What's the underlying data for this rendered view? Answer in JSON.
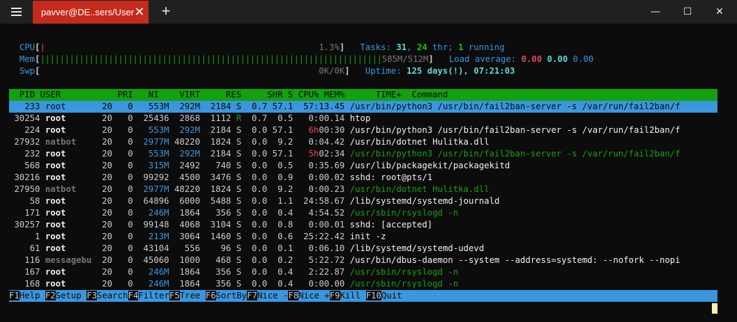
{
  "window": {
    "tab_title": "pavver@DE..sers/User",
    "tab_close": "✕",
    "new_tab": "+",
    "minimize": "—",
    "maximize": "☐",
    "close": "✕"
  },
  "meters": {
    "cpu_label": "CPU",
    "cpu_bar": "|",
    "cpu_value": "1.3%",
    "mem_label": "Mem",
    "mem_bar": "||||||||||||||||||||||||||||||||||||||||||||||||||||||||||||||||||||||",
    "mem_value": "585M/512M",
    "swp_label": "Swp",
    "swp_value": "0K/0K"
  },
  "summary": {
    "tasks_label": "Tasks:",
    "tasks": "31",
    "threads": "24",
    "threads_label": "thr;",
    "running": "1",
    "running_label": "running",
    "load_label": "Load average:",
    "load_1": "0.00",
    "load_5": "0.00",
    "load_15": "0.00",
    "uptime_label": "Uptime:",
    "uptime_value": "125 days(!), 07:21:03"
  },
  "table": {
    "columns": [
      "PID",
      "USER",
      "PRI",
      "NI",
      "VIRT",
      "RES",
      "SHR",
      "S",
      "CPU%",
      "MEM%",
      "TIME+",
      "Command"
    ],
    "rows": [
      {
        "pid": "233",
        "user": "root",
        "pri": "20",
        "ni": "0",
        "virt": "553M",
        "res": "292M",
        "shr": "2184",
        "s": "S",
        "cpu": "0.7",
        "mem": "57.1",
        "time": "57:13.45",
        "cmd": "/usr/bin/python3 /usr/bin/fail2ban-server -s /var/run/fail2ban/f"
      },
      {
        "pid": "30254",
        "user": "root",
        "pri": "20",
        "ni": "0",
        "virt": "25436",
        "res": "2868",
        "shr": "1112",
        "s": "R",
        "cpu": "0.7",
        "mem": "0.5",
        "time": "0:00.14",
        "cmd": "htop"
      },
      {
        "pid": "224",
        "user": "root",
        "pri": "20",
        "ni": "0",
        "virt": "553M",
        "res": "292M",
        "shr": "2184",
        "s": "S",
        "cpu": "0.0",
        "mem": "57.1",
        "time": "6h00:30",
        "cmd": "/usr/bin/python3 /usr/bin/fail2ban-server -s /var/run/fail2ban/f"
      },
      {
        "pid": "27932",
        "user": "natbot",
        "pri": "20",
        "ni": "0",
        "virt": "2977M",
        "res": "48220",
        "shr": "1824",
        "s": "S",
        "cpu": "0.0",
        "mem": "9.2",
        "time": "0:04.42",
        "cmd": "/usr/bin/dotnet Hulitka.dll"
      },
      {
        "pid": "232",
        "user": "root",
        "pri": "20",
        "ni": "0",
        "virt": "553M",
        "res": "292M",
        "shr": "2184",
        "s": "S",
        "cpu": "0.0",
        "mem": "57.1",
        "time": "5h02:34",
        "cmd": "/usr/bin/python3 /usr/bin/fail2ban-server -s /var/run/fail2ban/f"
      },
      {
        "pid": "568",
        "user": "root",
        "pri": "20",
        "ni": "0",
        "virt": "315M",
        "res": "2492",
        "shr": "740",
        "s": "S",
        "cpu": "0.0",
        "mem": "0.5",
        "time": "0:35.69",
        "cmd": "/usr/lib/packagekit/packagekitd"
      },
      {
        "pid": "30216",
        "user": "root",
        "pri": "20",
        "ni": "0",
        "virt": "99292",
        "res": "4500",
        "shr": "3476",
        "s": "S",
        "cpu": "0.0",
        "mem": "0.9",
        "time": "0:00.02",
        "cmd": "sshd: root@pts/1"
      },
      {
        "pid": "27950",
        "user": "natbot",
        "pri": "20",
        "ni": "0",
        "virt": "2977M",
        "res": "48220",
        "shr": "1824",
        "s": "S",
        "cpu": "0.0",
        "mem": "9.2",
        "time": "0:00.23",
        "cmd": "/usr/bin/dotnet Hulitka.dll"
      },
      {
        "pid": "58",
        "user": "root",
        "pri": "20",
        "ni": "0",
        "virt": "64896",
        "res": "6000",
        "shr": "5488",
        "s": "S",
        "cpu": "0.0",
        "mem": "1.1",
        "time": "24:58.67",
        "cmd": "/lib/systemd/systemd-journald"
      },
      {
        "pid": "171",
        "user": "root",
        "pri": "20",
        "ni": "0",
        "virt": "246M",
        "res": "1864",
        "shr": "356",
        "s": "S",
        "cpu": "0.0",
        "mem": "0.4",
        "time": "4:54.52",
        "cmd": "/usr/sbin/rsyslogd -n"
      },
      {
        "pid": "30257",
        "user": "root",
        "pri": "20",
        "ni": "0",
        "virt": "99148",
        "res": "4068",
        "shr": "3104",
        "s": "S",
        "cpu": "0.0",
        "mem": "0.8",
        "time": "0:00.01",
        "cmd": "sshd: [accepted]"
      },
      {
        "pid": "1",
        "user": "root",
        "pri": "20",
        "ni": "0",
        "virt": "213M",
        "res": "3064",
        "shr": "1460",
        "s": "S",
        "cpu": "0.0",
        "mem": "0.6",
        "time": "25:22.42",
        "cmd": "init -z"
      },
      {
        "pid": "61",
        "user": "root",
        "pri": "20",
        "ni": "0",
        "virt": "43104",
        "res": "556",
        "shr": "96",
        "s": "S",
        "cpu": "0.0",
        "mem": "0.1",
        "time": "0:06.10",
        "cmd": "/lib/systemd/systemd-udevd"
      },
      {
        "pid": "116",
        "user": "messagebu",
        "pri": "20",
        "ni": "0",
        "virt": "45060",
        "res": "1000",
        "shr": "468",
        "s": "S",
        "cpu": "0.0",
        "mem": "0.2",
        "time": "5:22.72",
        "cmd": "/usr/bin/dbus-daemon --system --address=systemd: --nofork --nopi"
      },
      {
        "pid": "167",
        "user": "root",
        "pri": "20",
        "ni": "0",
        "virt": "246M",
        "res": "1864",
        "shr": "356",
        "s": "S",
        "cpu": "0.0",
        "mem": "0.4",
        "time": "2:22.87",
        "cmd": "/usr/sbin/rsyslogd -n"
      },
      {
        "pid": "168",
        "user": "root",
        "pri": "20",
        "ni": "0",
        "virt": "246M",
        "res": "1864",
        "shr": "356",
        "s": "S",
        "cpu": "0.0",
        "mem": "0.4",
        "time": "0:00.00",
        "cmd": "/usr/sbin/rsyslogd -n"
      }
    ]
  },
  "function_keys": [
    {
      "key": "F1",
      "label": "Help"
    },
    {
      "key": "F2",
      "label": "Setup"
    },
    {
      "key": "F3",
      "label": "Search"
    },
    {
      "key": "F4",
      "label": "Filter"
    },
    {
      "key": "F5",
      "label": "Tree"
    },
    {
      "key": "F6",
      "label": "SortBy"
    },
    {
      "key": "F7",
      "label": "Nice -"
    },
    {
      "key": "F8",
      "label": "Nice +"
    },
    {
      "key": "F9",
      "label": "Kill"
    },
    {
      "key": "F10",
      "label": "Quit"
    }
  ],
  "colors": {
    "tab_active": "#c42b1c",
    "titlebar": "#202020",
    "terminal_bg": "#0c0c0c",
    "header_bg": "#13a10e",
    "selection_bg": "#3a96dd"
  }
}
